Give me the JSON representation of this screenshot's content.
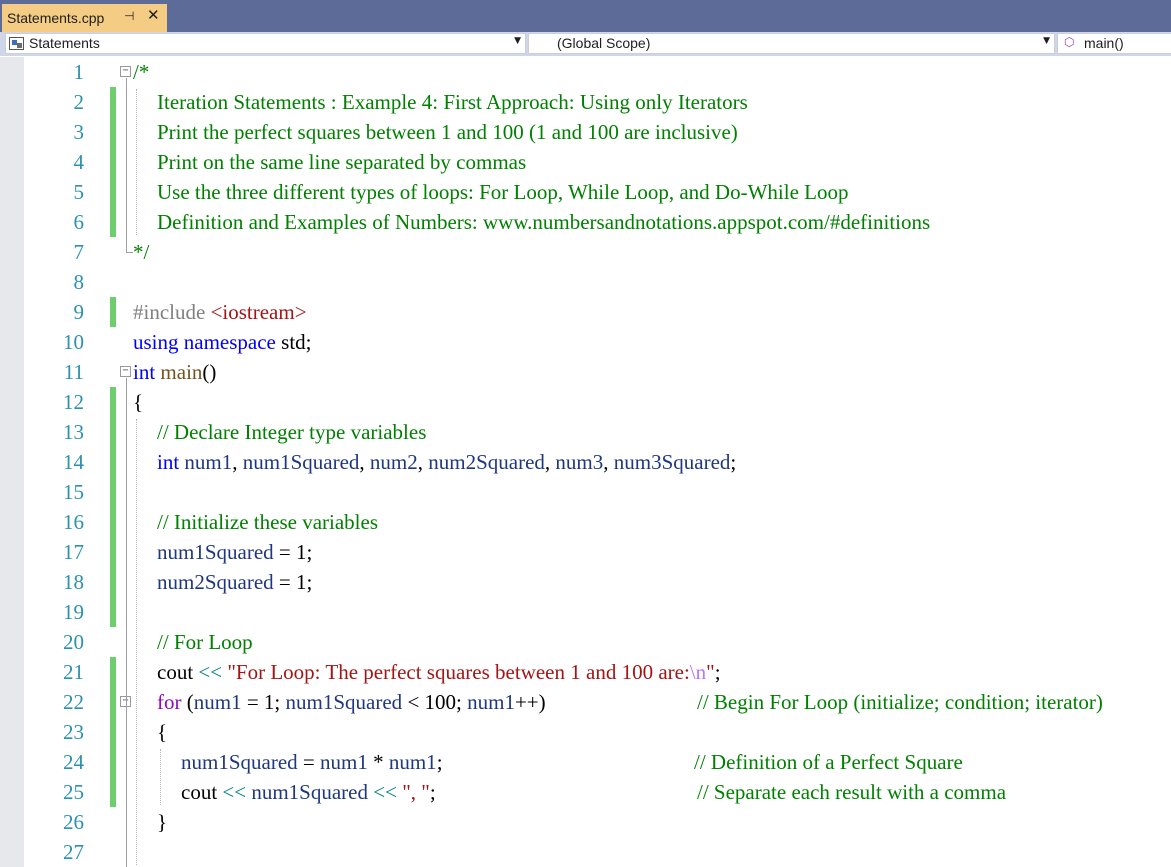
{
  "tab": {
    "title": "Statements.cpp",
    "pin_glyph": "⊣",
    "close_glyph": "✕"
  },
  "navigation": {
    "project": "Statements",
    "scope": "(Global Scope)",
    "member": "main()",
    "dropdown_glyph": "▼"
  },
  "icons": {
    "project": "project-icon",
    "member": "function-cube-icon",
    "pin": "pin-icon",
    "close": "close-icon"
  },
  "colors": {
    "tab_bg": "#f5cc84",
    "tabstrip_bg": "#5d6b99",
    "comment": "#008000",
    "keyword": "#0000ff",
    "string": "#a31515",
    "line_number": "#2b91af",
    "change_marker": "#6ece6e"
  },
  "code_lines": [
    {
      "n": "1",
      "tokens": [
        {
          "t": "/*",
          "c": "comment"
        }
      ]
    },
    {
      "n": "2",
      "tokens": [
        {
          "t": "Iteration Statements : Example 4: First Approach: Using only Iterators",
          "c": "comment"
        }
      ]
    },
    {
      "n": "3",
      "tokens": [
        {
          "t": "Print the perfect squares between 1 and 100 (1 and 100 are inclusive)",
          "c": "comment"
        }
      ]
    },
    {
      "n": "4",
      "tokens": [
        {
          "t": "Print on the same line separated by commas",
          "c": "comment"
        }
      ]
    },
    {
      "n": "5",
      "tokens": [
        {
          "t": "Use the three different types of loops: For Loop, While Loop, and Do-While Loop",
          "c": "comment"
        }
      ]
    },
    {
      "n": "6",
      "tokens": [
        {
          "t": "Definition and Examples of Numbers: www.numbersandnotations.appspot.com/#definitions",
          "c": "comment"
        }
      ]
    },
    {
      "n": "7",
      "tokens": [
        {
          "t": "*/",
          "c": "comment"
        }
      ]
    },
    {
      "n": "8",
      "tokens": []
    },
    {
      "n": "9",
      "tokens": [
        {
          "t": "#include ",
          "c": "preproc"
        },
        {
          "t": "<iostream>",
          "c": "string"
        }
      ]
    },
    {
      "n": "10",
      "tokens": [
        {
          "t": "using",
          "c": "keyword"
        },
        {
          "t": " ",
          "c": "plain"
        },
        {
          "t": "namespace",
          "c": "keyword"
        },
        {
          "t": " std;",
          "c": "plain"
        }
      ]
    },
    {
      "n": "11",
      "tokens": [
        {
          "t": "int",
          "c": "keyword"
        },
        {
          "t": " ",
          "c": "plain"
        },
        {
          "t": "main",
          "c": "func"
        },
        {
          "t": "()",
          "c": "plain"
        }
      ]
    },
    {
      "n": "12",
      "tokens": [
        {
          "t": "{",
          "c": "plain"
        }
      ]
    },
    {
      "n": "13",
      "tokens": [
        {
          "t": "// Declare Integer type variables",
          "c": "comment"
        }
      ]
    },
    {
      "n": "14",
      "tokens": [
        {
          "t": "int",
          "c": "keyword"
        },
        {
          "t": " ",
          "c": "plain"
        },
        {
          "t": "num1",
          "c": "var"
        },
        {
          "t": ", ",
          "c": "plain"
        },
        {
          "t": "num1Squared",
          "c": "var"
        },
        {
          "t": ", ",
          "c": "plain"
        },
        {
          "t": "num2",
          "c": "var"
        },
        {
          "t": ", ",
          "c": "plain"
        },
        {
          "t": "num2Squared",
          "c": "var"
        },
        {
          "t": ", ",
          "c": "plain"
        },
        {
          "t": "num3",
          "c": "var"
        },
        {
          "t": ", ",
          "c": "plain"
        },
        {
          "t": "num3Squared",
          "c": "var"
        },
        {
          "t": ";",
          "c": "plain"
        }
      ]
    },
    {
      "n": "15",
      "tokens": []
    },
    {
      "n": "16",
      "tokens": [
        {
          "t": "// Initialize these variables",
          "c": "comment"
        }
      ]
    },
    {
      "n": "17",
      "tokens": [
        {
          "t": "num1Squared",
          "c": "var"
        },
        {
          "t": " = 1;",
          "c": "plain"
        }
      ]
    },
    {
      "n": "18",
      "tokens": [
        {
          "t": "num2Squared",
          "c": "var"
        },
        {
          "t": " = 1;",
          "c": "plain"
        }
      ]
    },
    {
      "n": "19",
      "tokens": []
    },
    {
      "n": "20",
      "tokens": [
        {
          "t": "// For Loop",
          "c": "comment"
        }
      ]
    },
    {
      "n": "21",
      "tokens": [
        {
          "t": "cout",
          "c": "ns"
        },
        {
          "t": " ",
          "c": "plain"
        },
        {
          "t": "<<",
          "c": "op"
        },
        {
          "t": " ",
          "c": "plain"
        },
        {
          "t": "\"For Loop: The perfect squares between 1 and 100 are:",
          "c": "string"
        },
        {
          "t": "\\n",
          "c": "escape"
        },
        {
          "t": "\"",
          "c": "string"
        },
        {
          "t": ";",
          "c": "plain"
        }
      ]
    },
    {
      "n": "22",
      "tokens": [
        {
          "t": "for",
          "c": "control"
        },
        {
          "t": " (",
          "c": "plain"
        },
        {
          "t": "num1",
          "c": "var"
        },
        {
          "t": " = 1; ",
          "c": "plain"
        },
        {
          "t": "num1Squared",
          "c": "var"
        },
        {
          "t": " < 100; ",
          "c": "plain"
        },
        {
          "t": "num1",
          "c": "var"
        },
        {
          "t": "++)",
          "c": "plain"
        }
      ],
      "comment": "// Begin For Loop (initialize; condition; iterator)"
    },
    {
      "n": "23",
      "tokens": [
        {
          "t": "{",
          "c": "plain"
        }
      ]
    },
    {
      "n": "24",
      "tokens": [
        {
          "t": "num1Squared",
          "c": "var"
        },
        {
          "t": " = ",
          "c": "plain"
        },
        {
          "t": "num1",
          "c": "var"
        },
        {
          "t": " * ",
          "c": "plain"
        },
        {
          "t": "num1",
          "c": "var"
        },
        {
          "t": ";",
          "c": "plain"
        }
      ],
      "comment": "// Definition of a Perfect Square"
    },
    {
      "n": "25",
      "tokens": [
        {
          "t": "cout",
          "c": "ns"
        },
        {
          "t": " ",
          "c": "plain"
        },
        {
          "t": "<<",
          "c": "op"
        },
        {
          "t": " ",
          "c": "plain"
        },
        {
          "t": "num1Squared",
          "c": "var"
        },
        {
          "t": " ",
          "c": "plain"
        },
        {
          "t": "<<",
          "c": "op"
        },
        {
          "t": " ",
          "c": "plain"
        },
        {
          "t": "\", \"",
          "c": "string"
        },
        {
          "t": ";",
          "c": "plain"
        }
      ],
      "comment": "// Separate each result with a comma"
    },
    {
      "n": "26",
      "tokens": [
        {
          "t": "}",
          "c": "plain"
        }
      ]
    },
    {
      "n": "27",
      "tokens": []
    }
  ]
}
